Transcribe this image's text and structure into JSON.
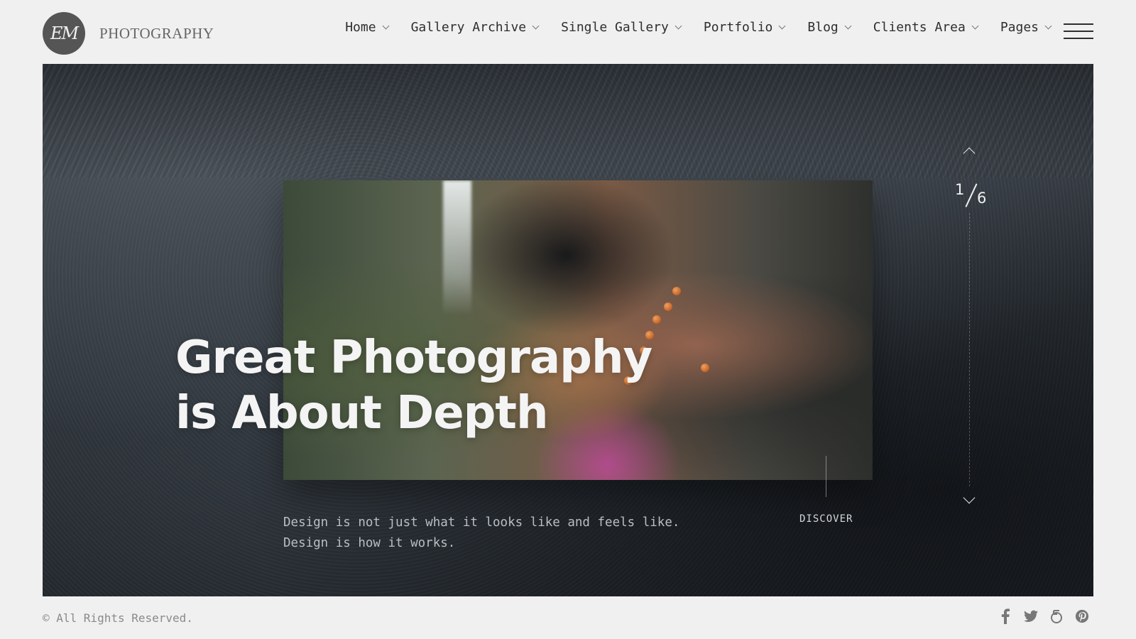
{
  "header": {
    "logo_monogram": "EM",
    "logo_text": "PHOTOGRAPHY",
    "nav": [
      {
        "label": "Home"
      },
      {
        "label": "Gallery Archive"
      },
      {
        "label": "Single Gallery"
      },
      {
        "label": "Portfolio"
      },
      {
        "label": "Blog"
      },
      {
        "label": "Clients Area"
      },
      {
        "label": "Pages"
      }
    ],
    "menu_icon": "hamburger-menu-icon"
  },
  "hero": {
    "headline_line1": "Great Photography",
    "headline_line2": "is About Depth",
    "tagline_line1": "Design is not just what it looks like and feels like.",
    "tagline_line2": "Design is how it works.",
    "cta_label": "DISCOVER",
    "slide_current": "1",
    "slide_total": "6"
  },
  "footer": {
    "copyright": "© All Rights Reserved.",
    "social": [
      "facebook-icon",
      "twitter-icon",
      "500px-icon",
      "pinterest-icon"
    ]
  },
  "colors": {
    "page_bg": "#f0f0f0",
    "nav_text": "#2e2e2e",
    "logo_badge": "#555555",
    "hero_dark": "#2a3036",
    "headline": "#f4f4f4",
    "muted_text": "#8a8a8a"
  }
}
